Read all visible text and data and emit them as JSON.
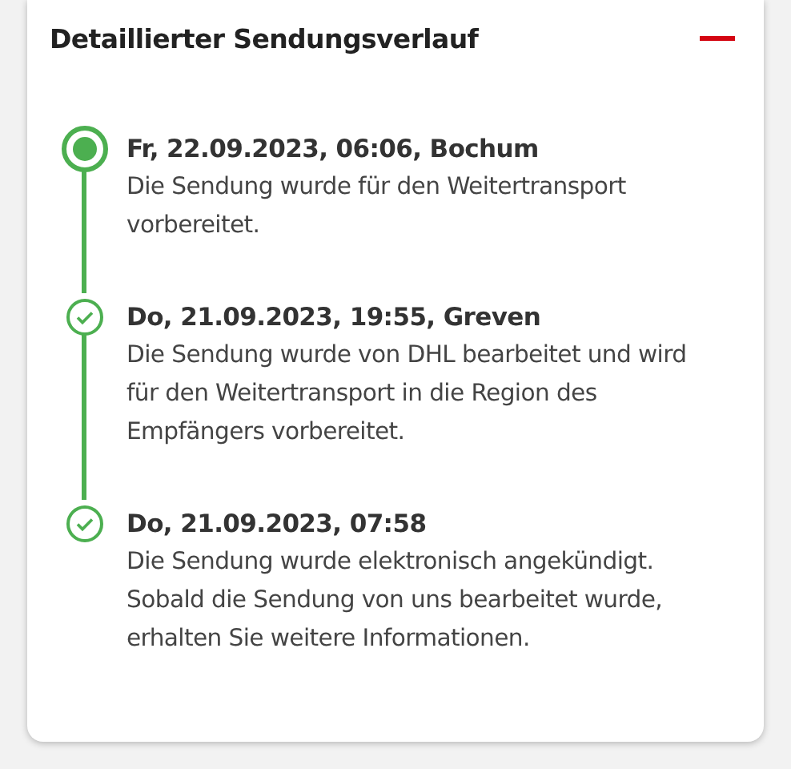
{
  "panel": {
    "title": "Detaillierter Sendungsverlauf",
    "expanded": true
  },
  "events": [
    {
      "kind": "current",
      "heading": "Fr, 22.09.2023, 06:06, Bochum",
      "lines": [
        "Die Sendung wurde für den Weitertransport",
        "vorbereitet."
      ]
    },
    {
      "kind": "done",
      "heading": "Do, 21.09.2023, 19:55, Greven",
      "lines": [
        "Die Sendung wurde von DHL bearbeitet und wird",
        "für den Weitertransport in die Region des",
        "Empfängers vorbereitet."
      ]
    },
    {
      "kind": "done",
      "heading": "Do, 21.09.2023, 07:58",
      "lines": [
        "Die Sendung wurde elektronisch angekündigt.",
        "Sobald die Sendung von uns bearbeitet wurde,",
        "erhalten Sie weitere Informationen."
      ]
    }
  ]
}
